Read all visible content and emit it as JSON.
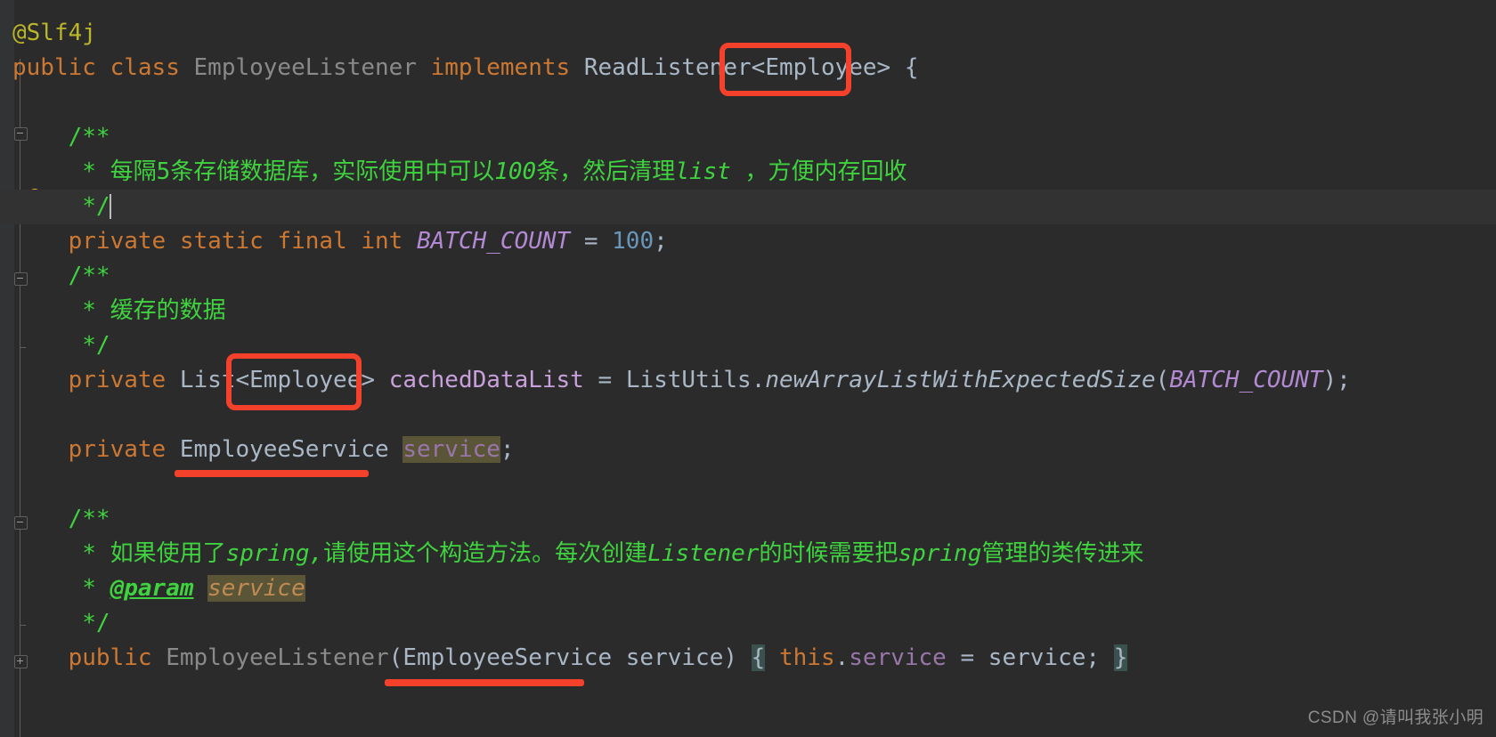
{
  "editor": {
    "theme_background": "#2b2b2b",
    "gutter_background": "#313335",
    "caret_line_background": "#323232",
    "annotation_color": "#f4412b",
    "language": "java"
  },
  "icons": {
    "lightbulb": "lightbulb-intention-icon",
    "fold_collapse": "fold-collapse-icon",
    "fold_expand": "fold-expand-icon"
  },
  "code_lines": [
    {
      "id": "line-annotation",
      "tokens": [
        {
          "text": "@Slf4j",
          "style": "anno"
        }
      ]
    },
    {
      "id": "line-class-decl",
      "tokens": [
        {
          "text": "public",
          "style": "kw"
        },
        {
          "text": " ",
          "style": "plain"
        },
        {
          "text": "class",
          "style": "kw"
        },
        {
          "text": " ",
          "style": "plain"
        },
        {
          "text": "EmployeeListener",
          "style": "dim"
        },
        {
          "text": " ",
          "style": "plain"
        },
        {
          "text": "implements",
          "style": "kw"
        },
        {
          "text": " ",
          "style": "plain"
        },
        {
          "text": "ReadListener",
          "style": "cls"
        },
        {
          "text": "<Employee>",
          "style": "cls"
        },
        {
          "text": " {",
          "style": "cls"
        }
      ]
    },
    {
      "id": "line-blank-1",
      "tokens": []
    },
    {
      "id": "line-javadoc-1-open",
      "tokens": [
        {
          "text": "    /**",
          "style": "cmt"
        }
      ]
    },
    {
      "id": "line-javadoc-1-body",
      "tokens": [
        {
          "text": "     * ",
          "style": "cmt"
        },
        {
          "text": "每隔5条存储数据库，实际使用中可以",
          "style": "cmt"
        },
        {
          "text": "100",
          "style": "cmt-i"
        },
        {
          "text": "条，然后清理",
          "style": "cmt"
        },
        {
          "text": "list",
          "style": "cmt-i"
        },
        {
          "text": " ，方便内存回收",
          "style": "cmt"
        }
      ]
    },
    {
      "id": "line-javadoc-1-close",
      "tokens": [
        {
          "text": "     */",
          "style": "cmt"
        }
      ]
    },
    {
      "id": "line-batch-count",
      "tokens": [
        {
          "text": "    ",
          "style": "plain"
        },
        {
          "text": "private",
          "style": "kw"
        },
        {
          "text": " ",
          "style": "plain"
        },
        {
          "text": "static",
          "style": "kw"
        },
        {
          "text": " ",
          "style": "plain"
        },
        {
          "text": "final",
          "style": "kw"
        },
        {
          "text": " ",
          "style": "plain"
        },
        {
          "text": "int",
          "style": "kw"
        },
        {
          "text": " ",
          "style": "plain"
        },
        {
          "text": "BATCH_COUNT",
          "style": "const"
        },
        {
          "text": " = ",
          "style": "cls"
        },
        {
          "text": "100",
          "style": "num"
        },
        {
          "text": ";",
          "style": "cls"
        }
      ]
    },
    {
      "id": "line-javadoc-2-open",
      "tokens": [
        {
          "text": "    /**",
          "style": "cmt"
        }
      ]
    },
    {
      "id": "line-javadoc-2-body",
      "tokens": [
        {
          "text": "     * 缓存的数据",
          "style": "cmt"
        }
      ]
    },
    {
      "id": "line-javadoc-2-close",
      "tokens": [
        {
          "text": "     */",
          "style": "cmt"
        }
      ]
    },
    {
      "id": "line-cached-data-list",
      "tokens": [
        {
          "text": "    ",
          "style": "plain"
        },
        {
          "text": "private",
          "style": "kw"
        },
        {
          "text": " ",
          "style": "plain"
        },
        {
          "text": "List",
          "style": "cls"
        },
        {
          "text": "<Employee>",
          "style": "cls"
        },
        {
          "text": " ",
          "style": "plain"
        },
        {
          "text": "cachedDataList",
          "style": "field"
        },
        {
          "text": " = ",
          "style": "cls"
        },
        {
          "text": "ListUtils",
          "style": "cls"
        },
        {
          "text": ".",
          "style": "cls"
        },
        {
          "text": "newArrayListWithExpectedSize",
          "style": "mth"
        },
        {
          "text": "(",
          "style": "cls"
        },
        {
          "text": "BATCH_COUNT",
          "style": "const"
        },
        {
          "text": ");",
          "style": "cls"
        }
      ]
    },
    {
      "id": "line-blank-2",
      "tokens": []
    },
    {
      "id": "line-service-field",
      "tokens": [
        {
          "text": "    ",
          "style": "plain"
        },
        {
          "text": "private",
          "style": "kw"
        },
        {
          "text": " ",
          "style": "plain"
        },
        {
          "text": "EmployeeService",
          "style": "cls"
        },
        {
          "text": " ",
          "style": "plain"
        },
        {
          "text": "service",
          "style": "param-hl"
        },
        {
          "text": ";",
          "style": "cls"
        }
      ]
    },
    {
      "id": "line-blank-3",
      "tokens": []
    },
    {
      "id": "line-javadoc-3-open",
      "tokens": [
        {
          "text": "    /**",
          "style": "cmt"
        }
      ]
    },
    {
      "id": "line-javadoc-3-body",
      "tokens": [
        {
          "text": "     * ",
          "style": "cmt"
        },
        {
          "text": "如果使用了",
          "style": "cmt"
        },
        {
          "text": "spring,",
          "style": "cmt-i"
        },
        {
          "text": "请使用这个构造方法。每次创建",
          "style": "cmt"
        },
        {
          "text": "Listener",
          "style": "cmt-i"
        },
        {
          "text": "的时候需要把",
          "style": "cmt"
        },
        {
          "text": "spring",
          "style": "cmt-i"
        },
        {
          "text": "管理的类传进来",
          "style": "cmt"
        }
      ]
    },
    {
      "id": "line-javadoc-3-param",
      "tokens": [
        {
          "text": "     * ",
          "style": "cmt"
        },
        {
          "text": "@param",
          "style": "tag"
        },
        {
          "text": " ",
          "style": "cmt"
        },
        {
          "text": "service",
          "style": "param-doc"
        }
      ]
    },
    {
      "id": "line-javadoc-3-close",
      "tokens": [
        {
          "text": "     */",
          "style": "cmt"
        }
      ]
    },
    {
      "id": "line-constructor",
      "tokens": [
        {
          "text": "    ",
          "style": "plain"
        },
        {
          "text": "public",
          "style": "kw"
        },
        {
          "text": " ",
          "style": "plain"
        },
        {
          "text": "EmployeeListener",
          "style": "dim"
        },
        {
          "text": "(",
          "style": "cls"
        },
        {
          "text": "EmployeeService",
          "style": "cls"
        },
        {
          "text": " service)",
          "style": "cls"
        },
        {
          "text": " ",
          "style": "plain"
        },
        {
          "text": "{",
          "style": "brace-hl"
        },
        {
          "text": " ",
          "style": "plain"
        },
        {
          "text": "this",
          "style": "kw"
        },
        {
          "text": ".",
          "style": "cls"
        },
        {
          "text": "service",
          "style": "fieldp"
        },
        {
          "text": " = service;",
          "style": "cls"
        },
        {
          "text": " ",
          "style": "plain"
        },
        {
          "text": "}",
          "style": "brace-hl"
        }
      ]
    }
  ],
  "annotations": [
    {
      "name": "box-readlistener-generic",
      "shape": "box",
      "label": "<Employee>"
    },
    {
      "name": "box-list-generic",
      "shape": "box",
      "label": "<Employee>"
    },
    {
      "name": "underline-employeeservice",
      "shape": "underline",
      "label": "EmployeeService"
    },
    {
      "name": "underline-constructor",
      "shape": "underline",
      "label": "EmployeeService service"
    }
  ],
  "watermark": {
    "text": "CSDN @请叫我张小明"
  }
}
